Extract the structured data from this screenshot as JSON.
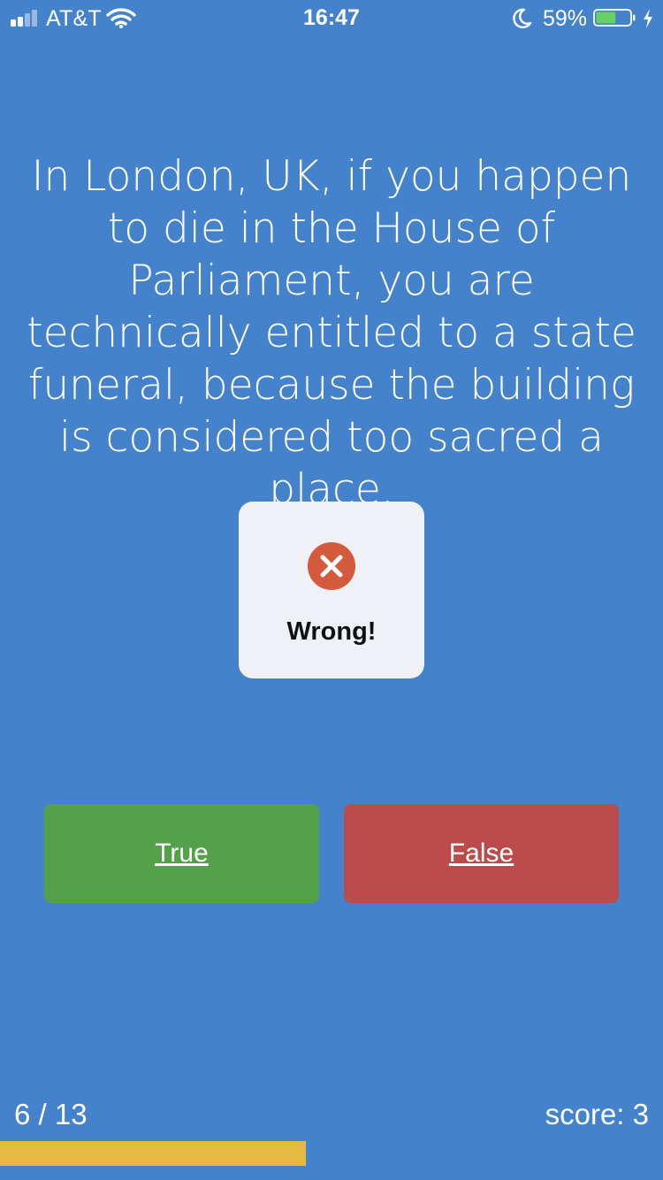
{
  "status_bar": {
    "carrier": "AT&T",
    "time": "16:47",
    "battery_percent": "59%",
    "battery_level": 0.59
  },
  "quiz": {
    "question": "In London, UK, if you happen to die in the House of Parliament, you are technically entitled to a state funeral, because the building is considered too sacred a place.",
    "feedback": {
      "icon": "x-circle-icon",
      "text": "Wrong!",
      "icon_color": "#d45a3c"
    },
    "answers": {
      "true_label": "True",
      "false_label": "False"
    },
    "progress": {
      "label": "6 / 13",
      "current": 6,
      "total": 13
    },
    "score_label": "score: 3"
  },
  "colors": {
    "background": "#4482cb",
    "true_button": "#55a04b",
    "false_button": "#bc4b4c",
    "progress_fill": "#e6b940",
    "feedback_card": "#eff1f6"
  }
}
